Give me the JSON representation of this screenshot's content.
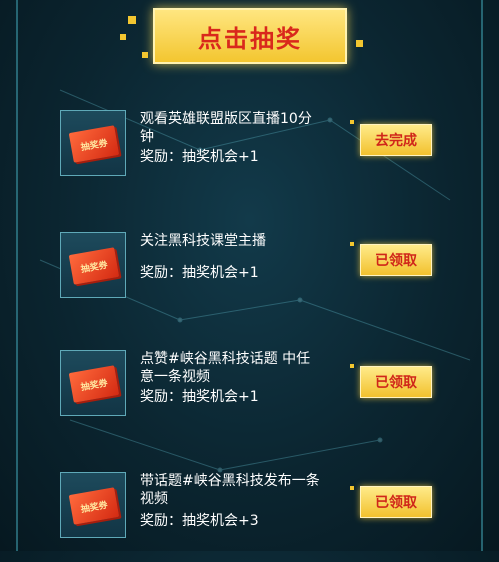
{
  "header": {
    "title": "点击抽奖"
  },
  "tasks": [
    {
      "title": "观看英雄联盟版区直播10分钟",
      "reward": "奖励：抽奖机会+1",
      "button": "去完成",
      "ticket_label": "抽奖券"
    },
    {
      "title": "关注黑科技课堂主播",
      "reward": "奖励：抽奖机会+1",
      "button": "已领取",
      "ticket_label": "抽奖券"
    },
    {
      "title": "点赞#峡谷黑科技话题 中任意一条视频",
      "reward": "奖励：抽奖机会+1",
      "button": "已领取",
      "ticket_label": "抽奖券"
    },
    {
      "title": "带话题#峡谷黑科技发布一条视频",
      "reward": "奖励：抽奖机会+3",
      "button": "已领取",
      "ticket_label": "抽奖券"
    }
  ],
  "colors": {
    "accent": "#f3c630",
    "button_text": "#d0261a",
    "background": "#0b2530"
  }
}
